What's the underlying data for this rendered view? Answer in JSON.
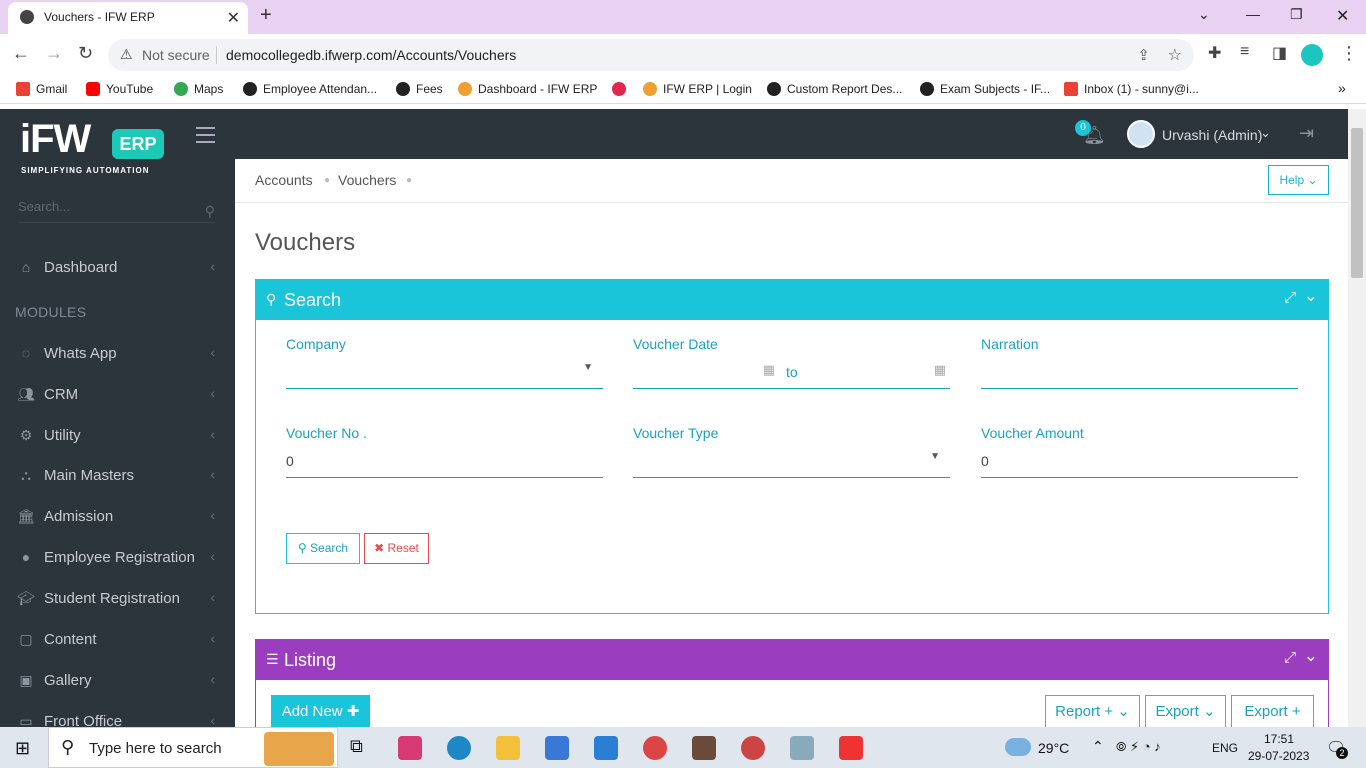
{
  "browser": {
    "tab_title": "Vouchers - IFW ERP",
    "not_secure": "Not secure",
    "url": "democollegedb.ifwerp.com/Accounts/Vouchers",
    "bookmarks": [
      "Gmail",
      "YouTube",
      "Maps",
      "Employee Attendan...",
      "Fees",
      "Dashboard - IFW ERP",
      "",
      "IFW ERP | Login",
      "Custom Report Des...",
      "Exam Subjects - IF...",
      "Inbox (1) - sunny@i..."
    ]
  },
  "logo": {
    "brand": "iFW",
    "badge": "ERP",
    "tagline": "SIMPLIFYING AUTOMATION"
  },
  "sidebar": {
    "search_placeholder": "Search...",
    "modules_heading": "MODULES",
    "items": [
      {
        "label": "Dashboard",
        "icon": "home-icon"
      },
      {
        "label": "Whats App",
        "icon": "whatsapp-icon"
      },
      {
        "label": "CRM",
        "icon": "users-icon"
      },
      {
        "label": "Utility",
        "icon": "gears-icon"
      },
      {
        "label": "Main Masters",
        "icon": "sitemap-icon"
      },
      {
        "label": "Admission",
        "icon": "bank-icon"
      },
      {
        "label": "Employee Registration",
        "icon": "user-icon"
      },
      {
        "label": "Student Registration",
        "icon": "graduation-cap-icon"
      },
      {
        "label": "Content",
        "icon": "file-icon"
      },
      {
        "label": "Gallery",
        "icon": "image-icon"
      },
      {
        "label": "Front Office",
        "icon": "desk-icon"
      }
    ]
  },
  "topbar": {
    "notification_count": "0",
    "user": "Urvashi (Admin)"
  },
  "breadcrumb": {
    "item1": "Accounts",
    "item2": "Vouchers"
  },
  "help_label": "Help",
  "page_title": "Vouchers",
  "search_panel": {
    "title": "Search",
    "company_label": "Company",
    "voucher_date_label": "Voucher Date",
    "date_to": "to",
    "narration_label": "Narration",
    "voucher_no_label": "Voucher No .",
    "voucher_no_value": "0",
    "voucher_type_label": "Voucher Type",
    "voucher_amount_label": "Voucher Amount",
    "voucher_amount_value": "0",
    "search_button": "Search",
    "reset_button": "Reset"
  },
  "listing_panel": {
    "title": "Listing",
    "add_new": "Add New",
    "report": "Report +",
    "export1": "Export",
    "export2": "Export +"
  },
  "taskbar": {
    "search_text": "Type here to search",
    "weather": "29°C",
    "lang": "ENG",
    "time": "17:51",
    "date": "29-07-2023",
    "notif": "2"
  },
  "colors": {
    "sidebar": "#2d353c",
    "search_panel": "#1ac4d9",
    "listing_panel": "#9b3dbf",
    "accent": "#17b6d0"
  }
}
